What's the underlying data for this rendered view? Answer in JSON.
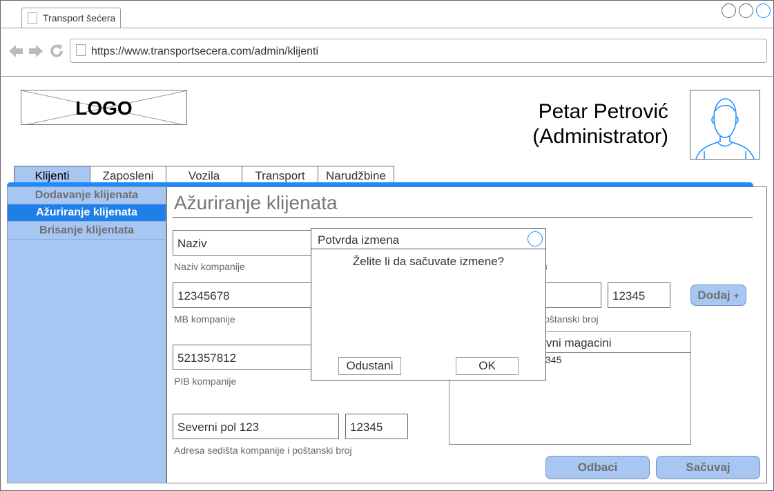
{
  "browser": {
    "tab_title": "Transport šećera",
    "url": "https://www.transportsecera.com/admin/klijenti"
  },
  "header": {
    "logo_text": "LOGO",
    "user_name": "Petar Petrović",
    "user_role": "(Administrator)"
  },
  "tabs": [
    {
      "label": "Klijenti",
      "active": true
    },
    {
      "label": "Zaposleni",
      "active": false
    },
    {
      "label": "Vozila",
      "active": false
    },
    {
      "label": "Transport",
      "active": false
    },
    {
      "label": "Narudžbine",
      "active": false
    }
  ],
  "sidebar": {
    "items": [
      {
        "label": "Dodavanje klijenata",
        "active": false
      },
      {
        "label": "Ažuriranje klijenata",
        "active": true
      },
      {
        "label": "Brisanje  klijentata",
        "active": false
      }
    ]
  },
  "main": {
    "title": "Ažuriranje klijenata",
    "naziv_value": "Naziv",
    "naziv_caption": "Naziv kompanije",
    "mb_value": "12345678",
    "mb_caption": "MB kompanije",
    "pib_value": "521357812",
    "pib_caption": "PIB kompanije",
    "address_value": "Severni pol 123",
    "postal_value": "12345",
    "address_caption": "Adresa sedišta kompanije i poštanski broj",
    "right_caption_fragment": "a",
    "warehouse_postal": "12345",
    "warehouse_caption_fragment": "oštanski broj",
    "add_button": "Dodaj",
    "add_icon": "+",
    "list_header_fragment": "vni magacini",
    "list_row_fragment": "345",
    "discard_button": "Odbaci",
    "save_button": "Sačuvaj"
  },
  "dialog": {
    "title": "Potvrda izmena",
    "message": "Želite li da sačuvate izmene?",
    "cancel": "Odustani",
    "ok": "OK"
  },
  "colors": {
    "accent": "#1a8cff",
    "tab_active": "#a8c6f2",
    "sidebar_active": "#1f7fe8"
  }
}
